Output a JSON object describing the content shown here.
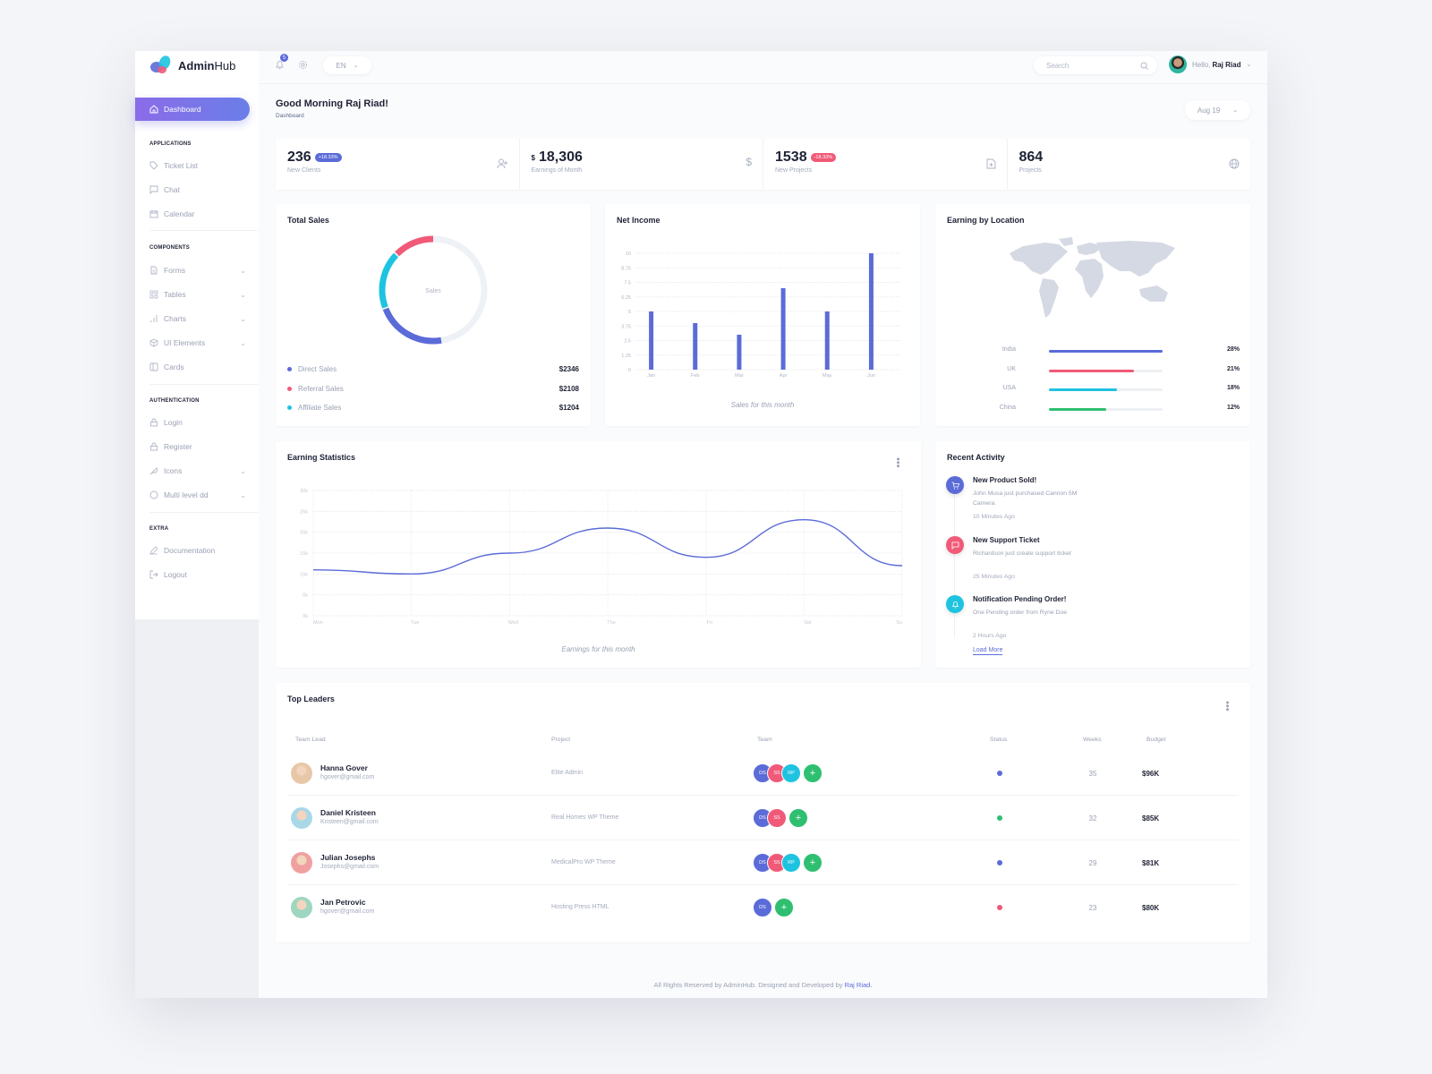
{
  "app": {
    "name_bold": "Admin",
    "name_light": "Hub"
  },
  "topbar": {
    "notification_count": "5",
    "language": "EN",
    "search_placeholder": "Search",
    "user_greeting": "Hello,",
    "user_name": "Raj Riad"
  },
  "sidebar": {
    "active": {
      "label": "Dashboard",
      "icon": "home-icon"
    },
    "sections": [
      {
        "title": "APPLICATIONS",
        "items": [
          {
            "label": "Ticket List",
            "icon": "tag-icon"
          },
          {
            "label": "Chat",
            "icon": "chat-icon"
          },
          {
            "label": "Calendar",
            "icon": "calendar-icon"
          }
        ]
      },
      {
        "title": "COMPONENTS",
        "items": [
          {
            "label": "Forms",
            "icon": "file-icon",
            "has_submenu": true
          },
          {
            "label": "Tables",
            "icon": "grid-icon",
            "has_submenu": true
          },
          {
            "label": "Charts",
            "icon": "bar-chart-icon",
            "has_submenu": true
          },
          {
            "label": "UI Elements",
            "icon": "box-icon",
            "has_submenu": true
          },
          {
            "label": "Cards",
            "icon": "columns-icon"
          }
        ]
      },
      {
        "title": "AUTHENTICATION",
        "items": [
          {
            "label": "Login",
            "icon": "lock-icon"
          },
          {
            "label": "Register",
            "icon": "lock-icon"
          },
          {
            "label": "Icons",
            "icon": "feather-icon",
            "has_submenu": true
          },
          {
            "label": "Multi level dd",
            "icon": "target-icon",
            "has_submenu": true
          }
        ]
      },
      {
        "title": "EXTRA",
        "items": [
          {
            "label": "Documentation",
            "icon": "pen-icon"
          },
          {
            "label": "Logout",
            "icon": "logout-icon"
          }
        ]
      }
    ]
  },
  "page": {
    "greeting": "Good Morning Raj Riad!",
    "breadcrumb": "Dashboard",
    "date_filter": "Aug 19"
  },
  "stats": [
    {
      "value": "236",
      "prefix": "",
      "badge": "+18.33%",
      "badge_color": "#5b6bd8",
      "label": "New Clients",
      "icon": "user-plus-icon"
    },
    {
      "value": "18,306",
      "prefix": "$",
      "badge": "",
      "label": "Earnings of Month",
      "icon": "dollar-icon"
    },
    {
      "value": "1538",
      "prefix": "",
      "badge": "-18.33%",
      "badge_color": "#f05a78",
      "label": "New Projects",
      "icon": "file-plus-icon"
    },
    {
      "value": "864",
      "prefix": "",
      "badge": "",
      "label": "Projects",
      "icon": "globe-icon"
    }
  ],
  "total_sales": {
    "title": "Total Sales",
    "center_label": "Sales",
    "items": [
      {
        "label": "Direct Sales",
        "value": "$2346",
        "color": "#5b6bd8"
      },
      {
        "label": "Referral Sales",
        "value": "$2108",
        "color": "#f05a78"
      },
      {
        "label": "Affiliate Sales",
        "value": "$1204",
        "color": "#1ec3e0"
      }
    ]
  },
  "location": {
    "title": "Earning by Location",
    "rows": [
      {
        "country": "India",
        "percent": "28%",
        "fill": 1.0,
        "color": "#5b6bd8"
      },
      {
        "country": "UK",
        "percent": "21%",
        "fill": 0.75,
        "color": "#f05a78"
      },
      {
        "country": "USA",
        "percent": "18%",
        "fill": 0.6,
        "color": "#1ec3e0"
      },
      {
        "country": "China",
        "percent": "12%",
        "fill": 0.5,
        "color": "#2fbf71"
      }
    ]
  },
  "activity": {
    "title": "Recent Activity",
    "items": [
      {
        "title": "New Product Sold!",
        "desc": "John Musa just purchased Cannon 5M Camera.",
        "time": "10 Minutes Ago",
        "color": "#5b6bd8",
        "icon": "cart-icon"
      },
      {
        "title": "New Support Ticket",
        "desc": "Richardson just create support ticket",
        "time": "25 Minutes Ago",
        "color": "#f05a78",
        "icon": "message-icon"
      },
      {
        "title": "Notification Pending Order!",
        "desc": "One Pending order from Ryne Doe",
        "time": "2 Hours Ago",
        "color": "#1ec3e0",
        "icon": "bell-icon"
      }
    ],
    "load_more": "Load More"
  },
  "leaders": {
    "title": "Top Leaders",
    "columns": [
      "Team Lead",
      "Project",
      "Team",
      "Status",
      "Weeks",
      "Budget"
    ],
    "rows": [
      {
        "name": "Hanna Gover",
        "email": "hgover@gmail.com",
        "project": "Elite Admin",
        "team": [
          "DS",
          "SS",
          "RP"
        ],
        "status_color": "#5b6bd8",
        "weeks": "35",
        "budget": "$96K",
        "avatar": "#e8c7a8"
      },
      {
        "name": "Daniel Kristeen",
        "email": "Kristeen@gmail.com",
        "project": "Real Homes WP Theme",
        "team": [
          "DS",
          "SS"
        ],
        "status_color": "#2fbf71",
        "weeks": "32",
        "budget": "$85K",
        "avatar": "#a8d8e8"
      },
      {
        "name": "Julian Josephs",
        "email": "Josephs@gmail.com",
        "project": "MedicalPro WP Theme",
        "team": [
          "DS",
          "SS",
          "RP"
        ],
        "status_color": "#5b6bd8",
        "weeks": "29",
        "budget": "$81K",
        "avatar": "#f0a0a0"
      },
      {
        "name": "Jan Petrovic",
        "email": "hgover@gmail.com",
        "project": "Hosting Press HTML",
        "team": [
          "DS"
        ],
        "status_color": "#f05a78",
        "weeks": "23",
        "budget": "$80K",
        "avatar": "#9ed6c0"
      }
    ],
    "team_colors": {
      "DS": "#5b6bd8",
      "SS": "#f05a78",
      "RP": "#1ec3e0"
    }
  },
  "footer": {
    "text": "All Rights Reserved by AdminHub. Designed and Developed by",
    "author": "Raj Riad."
  },
  "chart_data": [
    {
      "type": "pie",
      "title": "Total Sales",
      "categories": [
        "Direct Sales",
        "Referral Sales",
        "Affiliate Sales"
      ],
      "values": [
        2346,
        2108,
        1204
      ],
      "arc_fractions": [
        0.22,
        0.13,
        0.18
      ],
      "colors": [
        "#5b6bd8",
        "#f05a78",
        "#1ec3e0"
      ],
      "center_label": "Sales"
    },
    {
      "type": "bar",
      "title": "Net Income",
      "categories": [
        "Jan",
        "Feb",
        "Mar",
        "Apr",
        "May",
        "Jun"
      ],
      "values": [
        5,
        4,
        3,
        7,
        5,
        10
      ],
      "yticks": [
        "0",
        "1.25",
        "2.5",
        "3.75",
        "5",
        "6.25",
        "7.5",
        "8.75",
        "10"
      ],
      "ylim": [
        0,
        10
      ],
      "xlabel": "Sales for this month",
      "ylabel": "",
      "grid": true,
      "color": "#5b6bd8"
    },
    {
      "type": "line",
      "title": "Earning Statistics",
      "categories": [
        "Mon",
        "Tue",
        "Wed",
        "Thu",
        "Fri",
        "Sat",
        "Su"
      ],
      "values": [
        11000,
        10000,
        15000,
        21000,
        14000,
        23000,
        12000
      ],
      "yticks": [
        "0k",
        "5k",
        "10k",
        "15k",
        "20k",
        "25k",
        "30k"
      ],
      "ylim": [
        0,
        30000
      ],
      "xlabel": "Earnings for this month",
      "ylabel": "",
      "grid": true,
      "color": "#5b6bd8"
    }
  ]
}
